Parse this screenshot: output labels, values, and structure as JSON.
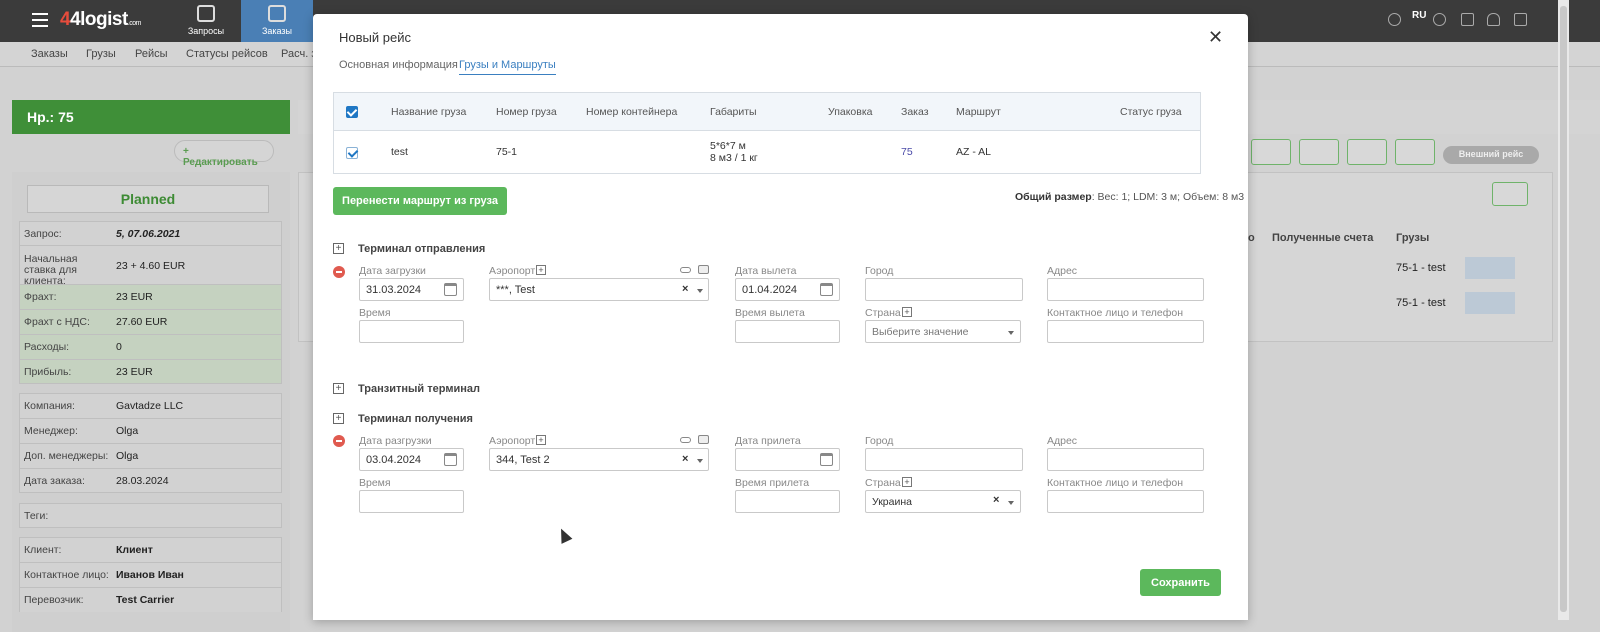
{
  "topbar": {
    "logo_main": "4logist",
    "logo_suffix": ".com",
    "nav": [
      {
        "label": "Запросы",
        "icon": "question-chat-icon"
      },
      {
        "label": "Заказы",
        "icon": "package-icon",
        "active": true
      }
    ],
    "lang": "RU"
  },
  "subnav": [
    "Заказы",
    "Грузы",
    "Рейсы",
    "Статусы рейсов",
    "Расч. з"
  ],
  "left": {
    "header": "Нр.: 75",
    "edit_label": "Редактировать",
    "status": "Planned",
    "rows": [
      {
        "k": "Запрос:",
        "v": "5, 07.06.2021"
      },
      {
        "k": "Начальная ставка для клиента:",
        "v": "23 + 4.60 EUR"
      },
      {
        "k": "Фрахт:",
        "v": "23 EUR"
      },
      {
        "k": "Фрахт с НДС:",
        "v": "27.60 EUR"
      },
      {
        "k": "Расходы:",
        "v": "0"
      },
      {
        "k": "Прибыль:",
        "v": "23 EUR"
      },
      {
        "k": "Компания:",
        "v": "Gavtadze LLC"
      },
      {
        "k": "Менеджер:",
        "v": "Olga"
      },
      {
        "k": "Доп. менеджеры:",
        "v": "Olga"
      },
      {
        "k": "Дата заказа:",
        "v": "28.03.2024"
      },
      {
        "k": "Теги:",
        "v": ""
      },
      {
        "k": "Клиент:",
        "v": "Клиент"
      },
      {
        "k": "Контактное лицо:",
        "v": "Иванов Иван"
      },
      {
        "k": "Перевозчик:",
        "v": "Test Carrier"
      }
    ]
  },
  "background": {
    "external_trip": "Внешний рейс",
    "col_invoices": "Полученные счета",
    "col_cargo": "Грузы",
    "col_cut": "о",
    "cargo_rows": [
      "75-1 - test",
      "75-1 - test"
    ]
  },
  "modal": {
    "title": "Новый рейс",
    "tabs": [
      "Основная информация",
      "Грузы и Маршруты"
    ],
    "table": {
      "headers": [
        "Название груза",
        "Номер груза",
        "Номер контейнера",
        "Габариты",
        "Упаковка",
        "Заказ",
        "Маршрут",
        "Статус груза"
      ],
      "row": {
        "name": "test",
        "number": "75-1",
        "container": "",
        "dims_line1": "5*6*7 м",
        "dims_line2": "8 м3 / 1 кг",
        "packing": "",
        "order": "75",
        "route": "AZ - AL",
        "status": ""
      }
    },
    "transfer_button": "Перенести маршрут из груза",
    "total_label": "Общий размер",
    "total_value": ": Вес: 1;  LDM: 3 м;  Объем: 8 м3",
    "departure": {
      "title": "Терминал отправления",
      "load_date_label": "Дата загрузки",
      "load_date": "31.03.2024",
      "airport_label": "Аэропорт",
      "airport": "***, Test",
      "depart_date_label": "Дата вылета",
      "depart_date": "01.04.2024",
      "city_label": "Город",
      "address_label": "Адрес",
      "time_label": "Время",
      "depart_time_label": "Время вылета",
      "country_label": "Страна",
      "country_placeholder": "Выберите значение",
      "contact_label": "Контактное лицо и телефон"
    },
    "transit": {
      "title": "Транзитный терминал"
    },
    "arrival": {
      "title": "Терминал получения",
      "unload_date_label": "Дата разгрузки",
      "unload_date": "03.04.2024",
      "airport_label": "Аэропорт",
      "airport": "344, Test 2",
      "arrive_date_label": "Дата прилета",
      "city_label": "Город",
      "address_label": "Адрес",
      "time_label": "Время",
      "arrive_time_label": "Время прилета",
      "country_label": "Страна",
      "country": "Украина",
      "contact_label": "Контактное лицо и телефон"
    },
    "save_label": "Сохранить"
  }
}
